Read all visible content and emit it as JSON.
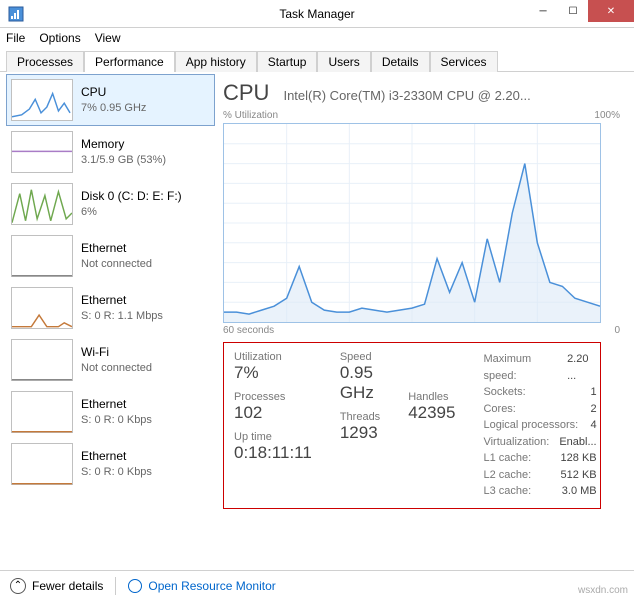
{
  "window": {
    "title": "Task Manager"
  },
  "menu": {
    "file": "File",
    "options": "Options",
    "view": "View"
  },
  "tabs": {
    "processes": "Processes",
    "performance": "Performance",
    "apphistory": "App history",
    "startup": "Startup",
    "users": "Users",
    "details": "Details",
    "services": "Services"
  },
  "sidebar": [
    {
      "name": "CPU",
      "sub": "7% 0.95 GHz",
      "color": "#4a90d9"
    },
    {
      "name": "Memory",
      "sub": "3.1/5.9 GB (53%)",
      "color": "#a97cc6"
    },
    {
      "name": "Disk 0 (C: D: E: F:)",
      "sub": "6%",
      "color": "#6fa84f"
    },
    {
      "name": "Ethernet",
      "sub": "Not connected",
      "color": "#888"
    },
    {
      "name": "Ethernet",
      "sub": "S: 0 R: 1.1 Mbps",
      "color": "#c4793a"
    },
    {
      "name": "Wi-Fi",
      "sub": "Not connected",
      "color": "#888"
    },
    {
      "name": "Ethernet",
      "sub": "S: 0 R: 0 Kbps",
      "color": "#c4793a"
    },
    {
      "name": "Ethernet",
      "sub": "S: 0 R: 0 Kbps",
      "color": "#c4793a"
    }
  ],
  "main": {
    "heading": "CPU",
    "cpu_name": "Intel(R) Core(TM) i3-2330M CPU @ 2.20...",
    "chart_top_left": "% Utilization",
    "chart_top_right": "100%",
    "chart_bottom_left": "60 seconds",
    "chart_bottom_right": "0"
  },
  "details": {
    "utilization_lbl": "Utilization",
    "utilization": "7%",
    "speed_lbl": "Speed",
    "speed": "0.95 GHz",
    "processes_lbl": "Processes",
    "processes": "102",
    "threads_lbl": "Threads",
    "threads": "1293",
    "handles_lbl": "Handles",
    "handles": "42395",
    "uptime_lbl": "Up time",
    "uptime": "0:18:11:11",
    "max_speed_lbl": "Maximum speed:",
    "max_speed": "2.20 ...",
    "sockets_lbl": "Sockets:",
    "sockets": "1",
    "cores_lbl": "Cores:",
    "cores": "2",
    "lp_lbl": "Logical processors:",
    "lp": "4",
    "virt_lbl": "Virtualization:",
    "virt": "Enabl...",
    "l1_lbl": "L1 cache:",
    "l1": "128 KB",
    "l2_lbl": "L2 cache:",
    "l2": "512 KB",
    "l3_lbl": "L3 cache:",
    "l3": "3.0 MB"
  },
  "footer": {
    "fewer": "Fewer details",
    "resmon": "Open Resource Monitor"
  },
  "watermark": "wsxdn.com",
  "chart_data": {
    "type": "line",
    "title": "% Utilization",
    "xlabel": "60 seconds → 0",
    "ylabel": "% Utilization",
    "ylim": [
      0,
      100
    ],
    "x_seconds_ago": [
      60,
      58,
      56,
      54,
      52,
      50,
      48,
      46,
      44,
      42,
      40,
      38,
      36,
      34,
      32,
      30,
      28,
      26,
      24,
      22,
      20,
      18,
      16,
      14,
      12,
      10,
      8,
      6,
      4,
      2,
      0
    ],
    "values": [
      5,
      5,
      4,
      6,
      8,
      12,
      28,
      10,
      6,
      5,
      5,
      7,
      6,
      5,
      6,
      7,
      9,
      32,
      15,
      30,
      10,
      42,
      20,
      55,
      80,
      40,
      20,
      18,
      12,
      10,
      8
    ]
  }
}
